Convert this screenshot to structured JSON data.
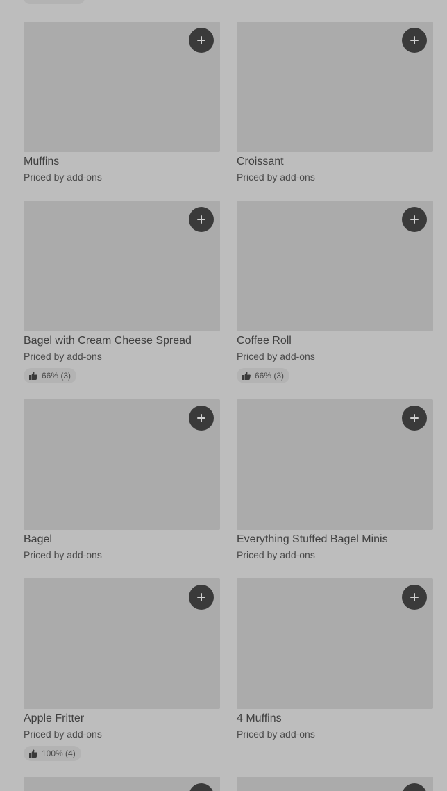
{
  "menu_items": [
    {
      "name": "Muffins",
      "price": "Priced by add-ons",
      "rating": null
    },
    {
      "name": "Croissant",
      "price": "Priced by add-ons",
      "rating": null
    },
    {
      "name": "Bagel with Cream Cheese Spread",
      "price": "Priced by add-ons",
      "rating": "66% (3)"
    },
    {
      "name": "Coffee Roll",
      "price": "Priced by add-ons",
      "rating": "66% (3)"
    },
    {
      "name": "Bagel",
      "price": "Priced by add-ons",
      "rating": null
    },
    {
      "name": "Everything Stuffed Bagel Minis",
      "price": "Priced by add-ons",
      "rating": null
    },
    {
      "name": "Apple Fritter",
      "price": "Priced by add-ons",
      "rating": "100% (4)"
    },
    {
      "name": "4 Muffins",
      "price": "Priced by add-ons",
      "rating": null
    }
  ],
  "icons": {
    "add": "plus-icon",
    "rating": "thumbs-up-icon"
  },
  "colors": {
    "overlay": "#bdbdbd",
    "button": "#3a3a3a",
    "placeholder": "#ababab"
  }
}
